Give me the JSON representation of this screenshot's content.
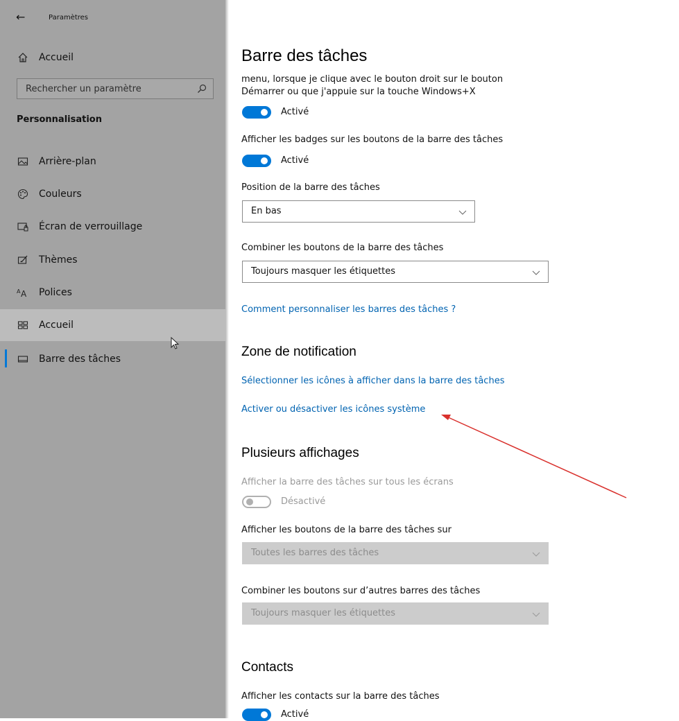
{
  "window": {
    "title": "Paramètres"
  },
  "sidebar": {
    "home": {
      "label": "Accueil",
      "icon": "home-icon"
    },
    "search": {
      "placeholder": "Rechercher un paramètre",
      "icon": "search-icon"
    },
    "section": "Personnalisation",
    "items": [
      {
        "label": "Arrière-plan",
        "icon": "picture-icon"
      },
      {
        "label": "Couleurs",
        "icon": "palette-icon"
      },
      {
        "label": "Écran de verrouillage",
        "icon": "lockscreen-icon"
      },
      {
        "label": "Thèmes",
        "icon": "themes-icon"
      },
      {
        "label": "Polices",
        "icon": "fonts-icon"
      },
      {
        "label": "Accueil",
        "icon": "start-icon"
      },
      {
        "label": "Barre des tâches",
        "icon": "taskbar-icon"
      }
    ],
    "hovered_item": "Accueil",
    "selected_item": "Barre des tâches",
    "accent": "#0078d7"
  },
  "main": {
    "title": "Barre des tâches",
    "intro_line1": "menu, lorsque je clique avec le bouton droit sur le bouton",
    "intro_line2": "Démarrer ou que j'appuie sur la touche Windows+X",
    "toggle1": {
      "state": "Activé",
      "on": true
    },
    "badges_label": "Afficher les badges sur les boutons de la barre des tâches",
    "toggle2": {
      "state": "Activé",
      "on": true
    },
    "position": {
      "label": "Position de la barre des tâches",
      "value": "En bas"
    },
    "combine": {
      "label": "Combiner les boutons de la barre des tâches",
      "value": "Toujours masquer les étiquettes"
    },
    "help_link": "Comment personnaliser les barres des tâches ?",
    "notif": {
      "heading": "Zone de notification",
      "link1": "Sélectionner les icônes à afficher dans la barre des tâches",
      "link2": "Activer ou désactiver les icônes système"
    },
    "multi": {
      "heading": "Plusieurs affichages",
      "all_screens_label": "Afficher la barre des tâches sur tous les écrans",
      "toggle": {
        "state": "Désactivé",
        "on": false
      },
      "buttons_on_label": "Afficher les boutons de la barre des tâches sur",
      "buttons_on_value": "Toutes les barres des tâches",
      "combine_other_label": "Combiner les boutons sur d’autres barres des tâches",
      "combine_other_value": "Toujours masquer les étiquettes"
    },
    "contacts": {
      "heading": "Contacts",
      "label": "Afficher les contacts sur la barre des tâches",
      "toggle": {
        "state": "Activé",
        "on": true
      }
    },
    "link_color": "#0063b1",
    "annotation_arrow_color": "#d9302c"
  }
}
